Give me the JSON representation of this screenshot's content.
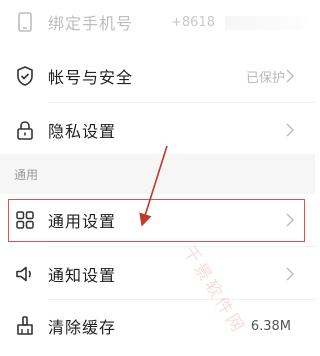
{
  "settings": {
    "phone": {
      "label": "绑定手机号",
      "value": "+8618"
    },
    "security": {
      "label": "帐号与安全",
      "value": "已保护"
    },
    "privacy": {
      "label": "隐私设置"
    },
    "section_general": "通用",
    "general": {
      "label": "通用设置"
    },
    "notify": {
      "label": "通知设置"
    },
    "cache": {
      "label": "清除缓存",
      "value": "6.38M"
    }
  },
  "watermark": "千景软件网",
  "colors": {
    "highlight": "#d9534f",
    "arrow": "#c0392b"
  }
}
